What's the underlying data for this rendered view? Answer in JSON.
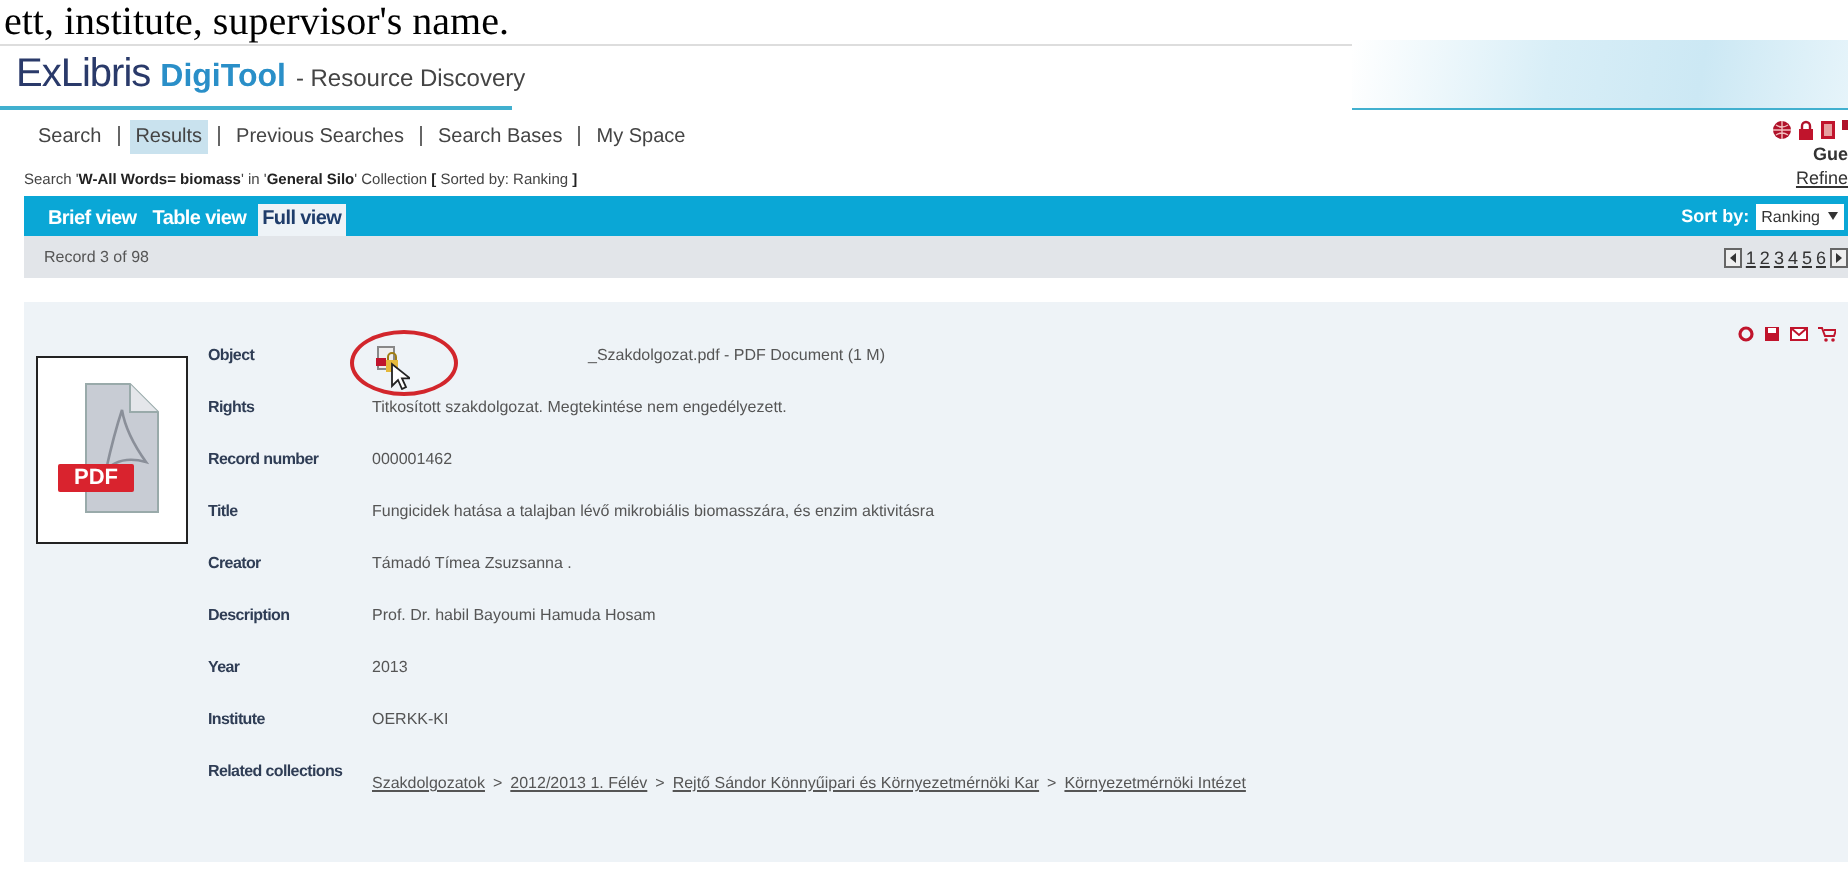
{
  "caption_fragment": "ett, institute, supervisor's name.",
  "logo": {
    "brand": "ExLibris",
    "product": "DigiTool",
    "subtitle": "- Resource Discovery"
  },
  "nav": [
    {
      "label": "Search",
      "selected": false
    },
    {
      "label": "Results",
      "selected": true
    },
    {
      "label": "Previous Searches",
      "selected": false
    },
    {
      "label": "Search Bases",
      "selected": false
    },
    {
      "label": "My Space",
      "selected": false
    }
  ],
  "user": {
    "name": "Gue",
    "refine": "Refine"
  },
  "search_summary": "Search '**W-All Words= biomass**' in '**General Silo**' Collection **[** Sorted by: Ranking **]**",
  "view_tabs": [
    {
      "label": "Brief view",
      "selected": false
    },
    {
      "label": "Table view",
      "selected": false
    },
    {
      "label": "Full view",
      "selected": true
    }
  ],
  "sort": {
    "label": "Sort by:",
    "value": "Ranking"
  },
  "record_position": "Record 3 of 98",
  "pages": [
    "1",
    "2",
    "3",
    "4",
    "5",
    "6"
  ],
  "thumbnail": {
    "badge": "PDF"
  },
  "fields": [
    {
      "kind": "object",
      "label": "Object",
      "value": "_Szakdolgozat.pdf - PDF Document (1 M)"
    },
    {
      "kind": "text",
      "label": "Rights",
      "value": "Titkosított szakdolgozat. Megtekintése nem engedélyezett."
    },
    {
      "kind": "text",
      "label": "Record number",
      "value": "000001462"
    },
    {
      "kind": "text",
      "label": "Title",
      "value": "Fungicidek hatása a talajban lévő mikrobiális biomasszára, és enzim aktivitásra"
    },
    {
      "kind": "text",
      "label": "Creator",
      "value": "Támadó Tímea Zsuzsanna ."
    },
    {
      "kind": "text",
      "label": "Description",
      "value": "Prof. Dr. habil Bayoumi Hamuda Hosam"
    },
    {
      "kind": "text",
      "label": "Year",
      "value": "2013"
    },
    {
      "kind": "text",
      "label": "Institute",
      "value": "OERKK-KI"
    },
    {
      "kind": "links",
      "label": "Related collections",
      "separator": ">",
      "links": [
        "Szakdolgozatok",
        "2012/2013 1. Félév",
        "Rejtő Sándor Könnyűipari és Környezetmérnöki Kar",
        "Környezetmérnöki Intézet"
      ]
    }
  ]
}
